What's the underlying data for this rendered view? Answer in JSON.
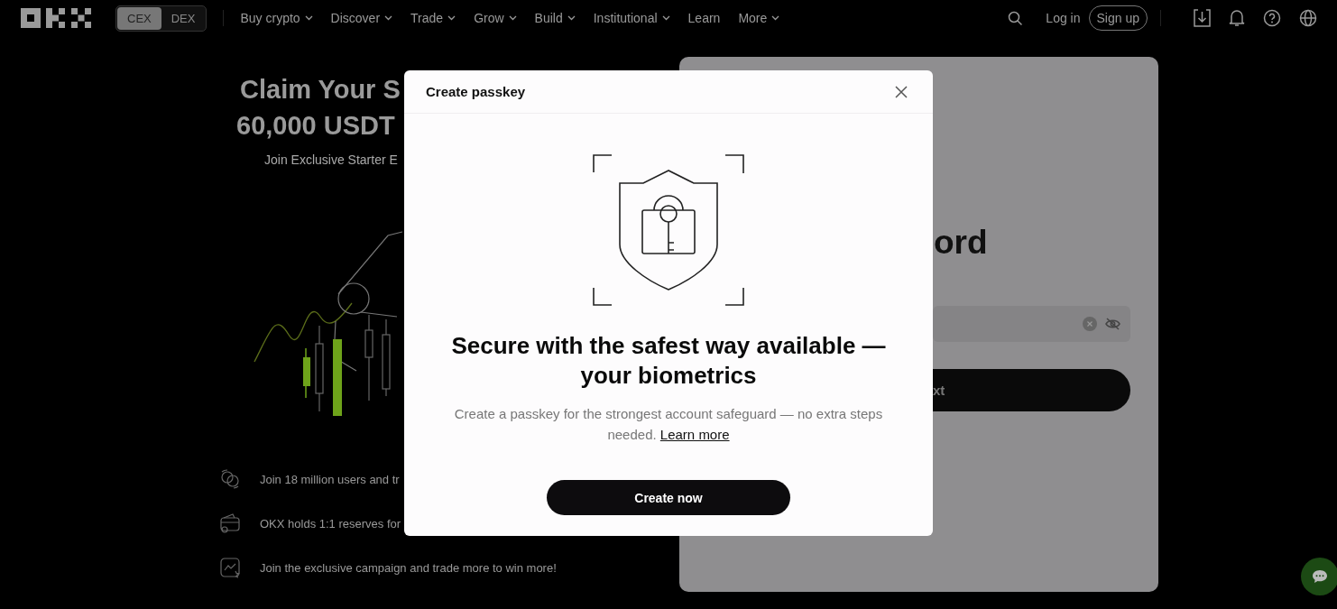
{
  "nav": {
    "exchange_toggle": [
      {
        "label": "CEX",
        "selected": true
      },
      {
        "label": "DEX",
        "selected": false
      }
    ],
    "menu": [
      {
        "label": "Buy crypto",
        "dropdown": true
      },
      {
        "label": "Discover",
        "dropdown": true
      },
      {
        "label": "Trade",
        "dropdown": true
      },
      {
        "label": "Grow",
        "dropdown": true
      },
      {
        "label": "Build",
        "dropdown": true
      },
      {
        "label": "Institutional",
        "dropdown": true
      },
      {
        "label": "Learn",
        "dropdown": false
      },
      {
        "label": "More",
        "dropdown": true
      }
    ],
    "login": "Log in",
    "signup": "Sign up"
  },
  "hero": {
    "title_lines": [
      "Claim Your S",
      "60,000 USDT"
    ],
    "subtitle": "Join Exclusive Starter E",
    "features": [
      "Join 18 million users and tr",
      "OKX holds 1:1 reserves for",
      "Join the exclusive campaign and trade more to win more!"
    ]
  },
  "login_card": {
    "heading": "ord",
    "button": "xt"
  },
  "modal": {
    "title": "Create passkey",
    "headline": "Secure with the safest way available — your biometrics",
    "description": "Create a passkey for the strongest account safeguard — no extra steps needed.",
    "link": "Learn more",
    "button": "Create now"
  }
}
